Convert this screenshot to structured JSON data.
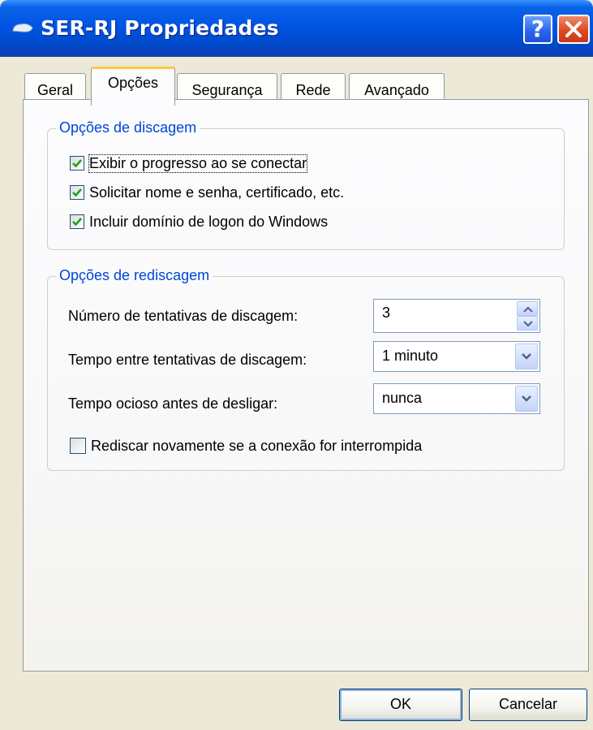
{
  "window": {
    "title": "SER-RJ Propriedades",
    "help_label": "?"
  },
  "tabs": [
    {
      "label": "Geral",
      "active": false
    },
    {
      "label": "Opções",
      "active": true
    },
    {
      "label": "Segurança",
      "active": false
    },
    {
      "label": "Rede",
      "active": false
    },
    {
      "label": "Avançado",
      "active": false
    }
  ],
  "dialing_options": {
    "legend": "Opções de discagem",
    "items": [
      {
        "label": "Exibir o progresso ao se conectar",
        "checked": true
      },
      {
        "label": "Solicitar nome e senha, certificado, etc.",
        "checked": true
      },
      {
        "label": "Incluir domínio de logon do Windows",
        "checked": true
      }
    ]
  },
  "redial_options": {
    "legend": "Opções de rediscagem",
    "attempts_label": "Número de tentativas de discagem:",
    "attempts_value": "3",
    "interval_label": "Tempo entre tentativas de discagem:",
    "interval_value": "1 minuto",
    "idle_label": "Tempo ocioso antes de desligar:",
    "idle_value": "nunca",
    "redial_checkbox_label": "Rediscar novamente se a conexão for interrompida",
    "redial_checked": false
  },
  "buttons": {
    "ok": "OK",
    "cancel": "Cancelar"
  },
  "colors": {
    "titlebar": "#0054e3",
    "group_legend": "#0046d5",
    "check_mark": "#21a121",
    "tab_highlight": "#ffc83c",
    "close_button": "#e0481e"
  }
}
